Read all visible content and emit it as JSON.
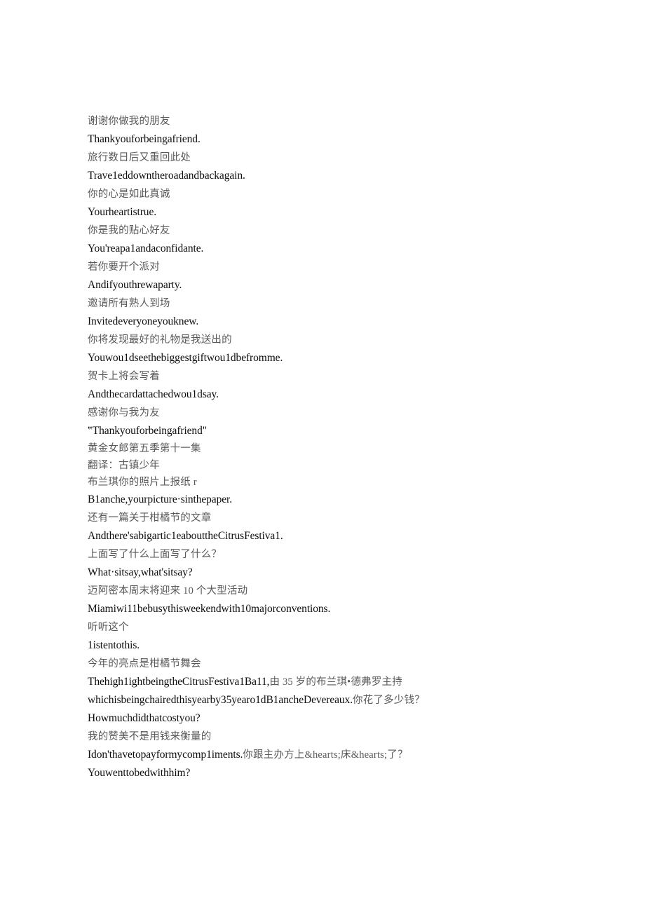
{
  "document": {
    "background_color": "#ffffff",
    "chinese_text_color": "#58595b",
    "english_text_color": "#0d0d0d",
    "lines": [
      {
        "id": "l01",
        "lang": "cn",
        "text": "谢谢你做我的朋友"
      },
      {
        "id": "l02",
        "lang": "en",
        "text": "Thankyouforbeingafriend."
      },
      {
        "id": "l03",
        "lang": "cn",
        "text": "旅行数日后又重回此处"
      },
      {
        "id": "l04",
        "lang": "en",
        "text": "Trave1eddowntheroadandbackagain."
      },
      {
        "id": "l05",
        "lang": "cn",
        "text": "你的心是如此真诚"
      },
      {
        "id": "l06",
        "lang": "en",
        "text": "Yourheartistrue."
      },
      {
        "id": "l07",
        "lang": "cn",
        "text": "你是我的贴心好友"
      },
      {
        "id": "l08",
        "lang": "en",
        "text": "You'reapa1andaconfidante."
      },
      {
        "id": "l09",
        "lang": "cn",
        "text": "若你要开个派对"
      },
      {
        "id": "l10",
        "lang": "en",
        "text": "Andifyouthrewaparty."
      },
      {
        "id": "l11",
        "lang": "cn",
        "text": "邀请所有熟人到场"
      },
      {
        "id": "l12",
        "lang": "en",
        "text": "Invitedeveryoneyouknew."
      },
      {
        "id": "l13",
        "lang": "cn",
        "text": "你将发现最好的礼物是我送出的"
      },
      {
        "id": "l14",
        "lang": "en",
        "text": "Youwou1dseethebiggestgiftwou1dbefromme."
      },
      {
        "id": "l15",
        "lang": "cn",
        "text": "贺卡上将会写着"
      },
      {
        "id": "l16",
        "lang": "en",
        "text": "Andthecardattachedwou1dsay."
      },
      {
        "id": "l17",
        "lang": "cn",
        "text": "感谢你与我为友"
      },
      {
        "id": "l18",
        "lang": "en",
        "text": "‟Thankyouforbeingafriend\""
      },
      {
        "id": "l19",
        "lang": "cn",
        "tight": true,
        "text": "黄金女郎第五季第十一集"
      },
      {
        "id": "l20",
        "lang": "cn",
        "tight": true,
        "text": "翻译：古镇少年"
      },
      {
        "id": "l21",
        "lang": "cn",
        "tight": true,
        "text": "布兰琪你的照片上报纸 r"
      },
      {
        "id": "l22",
        "lang": "en",
        "text": "B1anche,yourpicture·sinthepaper."
      },
      {
        "id": "l23",
        "lang": "cn",
        "text": "还有一篇关于柑橘节的文章"
      },
      {
        "id": "l24",
        "lang": "en",
        "text": "Andthere'sabigartic1eabouttheCitrusFestiva1."
      },
      {
        "id": "l25",
        "lang": "cn",
        "text": "上面写了什么上面写了什么？"
      },
      {
        "id": "l26",
        "lang": "en",
        "text": "What·sitsay,what'sitsay?"
      },
      {
        "id": "l27",
        "lang": "cn",
        "text": "迈阿密本周末将迎来 10 个大型活动"
      },
      {
        "id": "l28",
        "lang": "en",
        "text": "Miamiwi11bebusythisweekendwith10majorconventions."
      },
      {
        "id": "l29",
        "lang": "cn",
        "text": "听听这个"
      },
      {
        "id": "l30",
        "lang": "en",
        "text": "1istentothis."
      },
      {
        "id": "l31",
        "lang": "cn",
        "text": "今年的亮点是柑橘节舞会"
      }
    ],
    "mixed_paragraphs": [
      {
        "id": "p01",
        "segments": [
          {
            "lang": "en",
            "text": "Thehigh1ightbeingtheCitrusFestiva1Ba11,"
          },
          {
            "lang": "cn",
            "text": "由 35 岁的布兰琪•德弗罗主持"
          },
          {
            "lang": "en",
            "text": "whichisbeingchairedthisyearby35yearo1dB1ancheDevereaux."
          },
          {
            "lang": "cn",
            "text": "你花了多少钱？"
          }
        ]
      }
    ],
    "lines_after": [
      {
        "id": "l32",
        "lang": "en",
        "text": "Howmuchdidthatcostyou?"
      },
      {
        "id": "l33",
        "lang": "cn",
        "text": "我的赞美不是用钱来衡量的"
      }
    ],
    "mixed_paragraphs_2": [
      {
        "id": "p02",
        "segments": [
          {
            "lang": "en",
            "text": "Idon'thavetopayformycomp1iments."
          },
          {
            "lang": "cn",
            "text": "你跟主办方上&hearts;床&hearts;了？"
          }
        ]
      }
    ],
    "lines_final": [
      {
        "id": "l34",
        "lang": "en",
        "text": "Youwenttobedwithhim?"
      }
    ]
  }
}
